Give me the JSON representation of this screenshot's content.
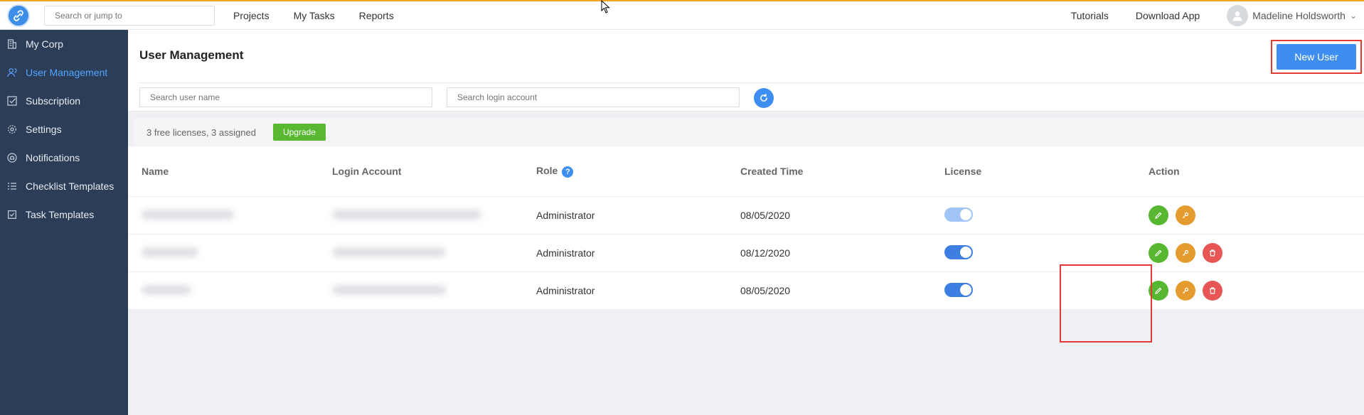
{
  "topbar": {
    "search_placeholder": "Search or jump to",
    "nav": [
      "Projects",
      "My Tasks",
      "Reports"
    ],
    "tutorials": "Tutorials",
    "download_app": "Download App",
    "user_name": "Madeline Holdsworth"
  },
  "sidebar": {
    "items": [
      {
        "label": "My Corp",
        "icon": "building-icon"
      },
      {
        "label": "User Management",
        "icon": "user-icon",
        "active": true
      },
      {
        "label": "Subscription",
        "icon": "subscription-icon"
      },
      {
        "label": "Settings",
        "icon": "gear-icon"
      },
      {
        "label": "Notifications",
        "icon": "bell-icon"
      },
      {
        "label": "Checklist Templates",
        "icon": "checklist-icon"
      },
      {
        "label": "Task Templates",
        "icon": "task-template-icon"
      }
    ]
  },
  "page": {
    "title": "User Management",
    "new_user": "New User",
    "search_user_placeholder": "Search user name",
    "search_login_placeholder": "Search login account",
    "license_text": "3 free licenses, 3 assigned",
    "upgrade": "Upgrade"
  },
  "table": {
    "headers": {
      "name": "Name",
      "login": "Login Account",
      "role": "Role",
      "created": "Created Time",
      "license": "License",
      "action": "Action"
    },
    "help": "?",
    "rows": [
      {
        "role": "Administrator",
        "created": "08/05/2020",
        "license_on": true
      },
      {
        "role": "Administrator",
        "created": "08/12/2020",
        "license_on": true
      },
      {
        "role": "Administrator",
        "created": "08/05/2020",
        "license_on": true
      }
    ]
  },
  "colors": {
    "accent": "#3d8ef0",
    "sidebar_bg": "#2c3e57",
    "top_border": "#f5a623",
    "upgrade_green": "#58b831",
    "edit_green": "#57b730",
    "key_orange": "#e69b2e",
    "delete_red": "#e85555",
    "highlight_red": "#e53935"
  }
}
